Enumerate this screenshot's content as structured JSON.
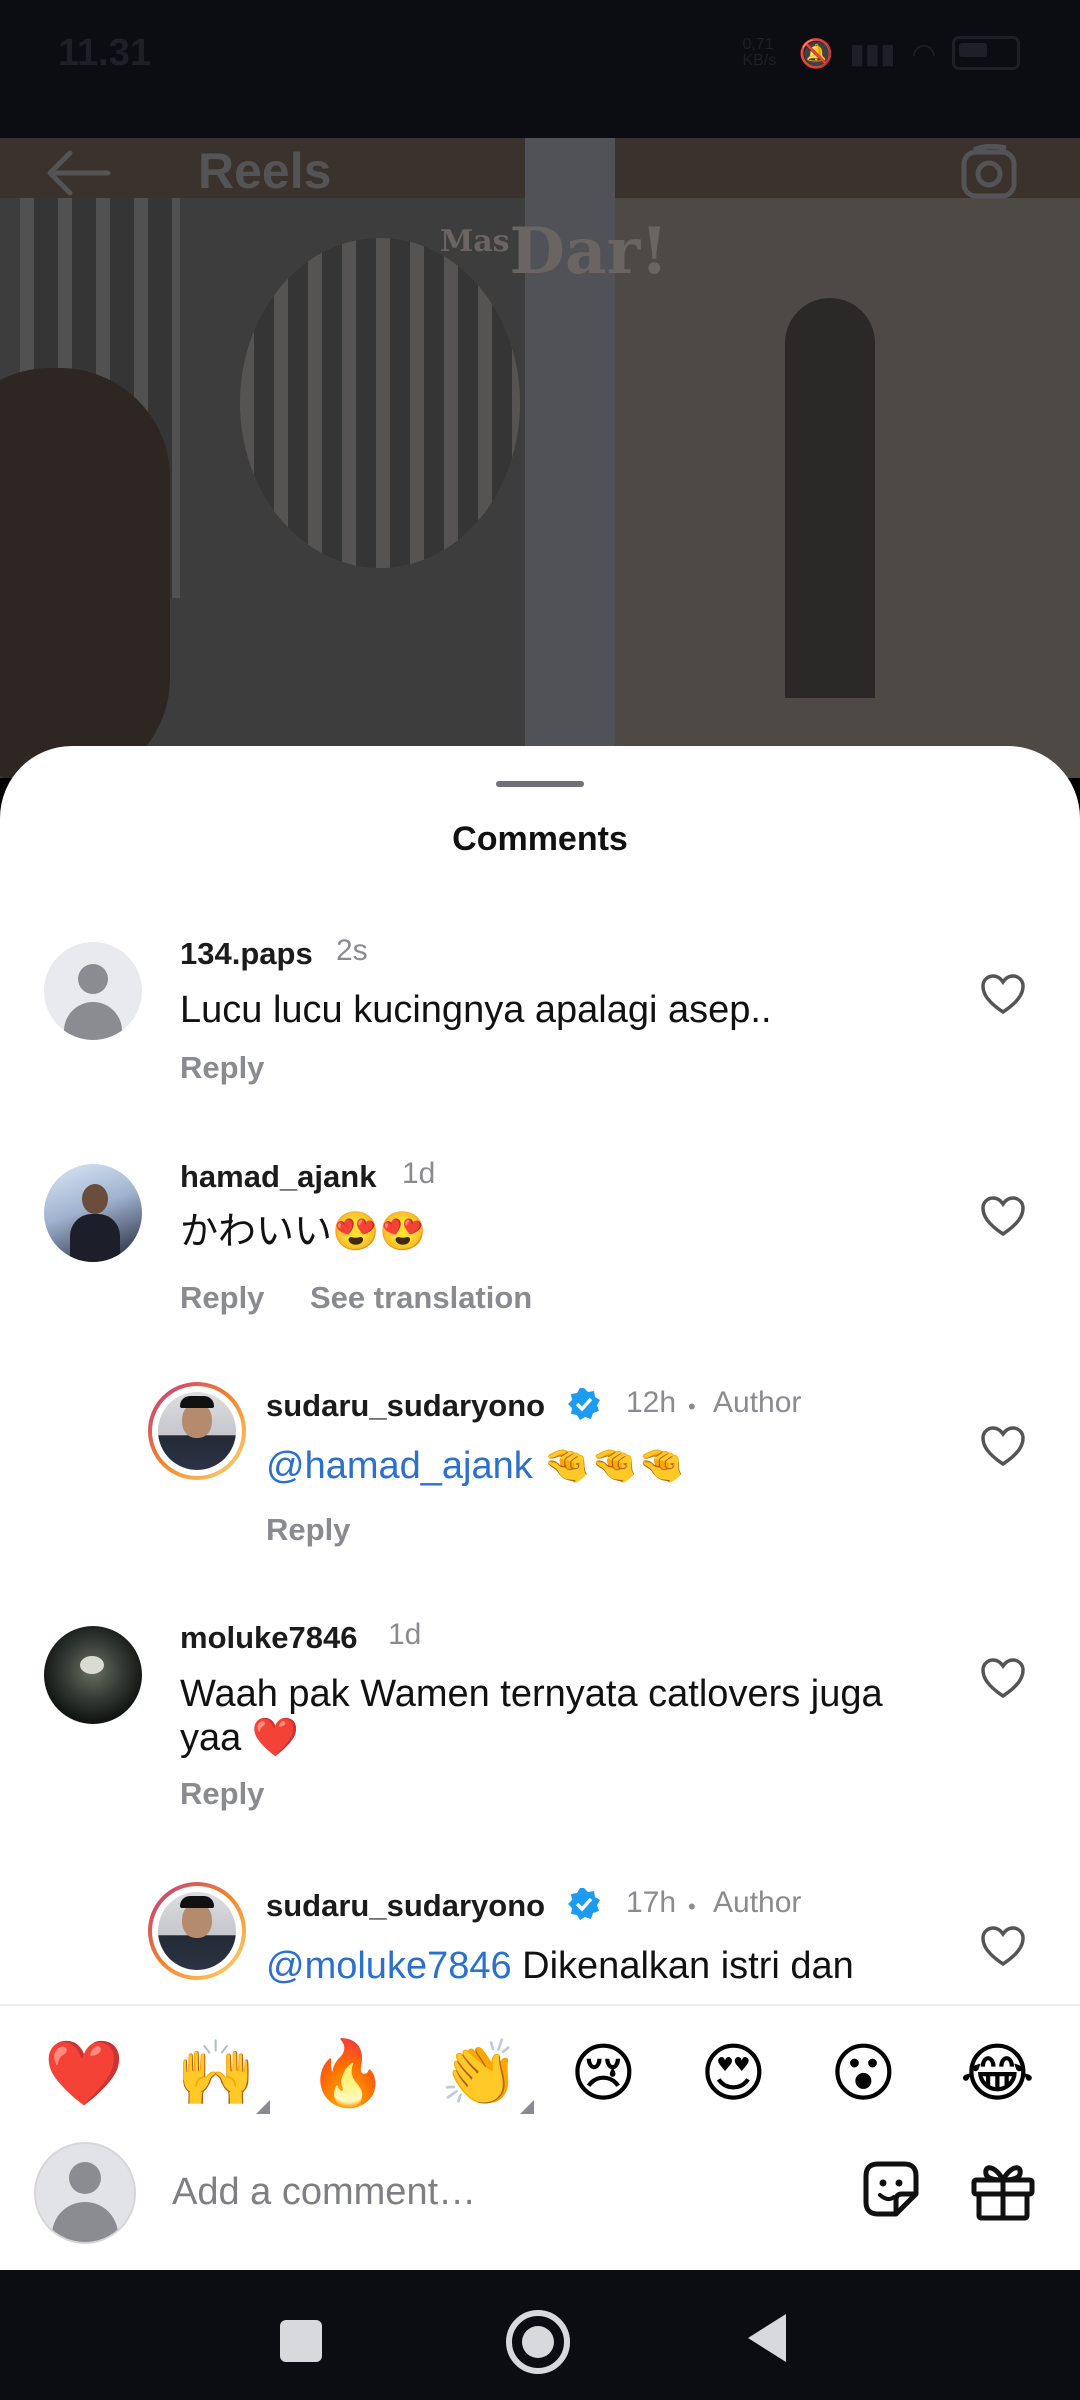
{
  "status_bar": {
    "time": "11.31",
    "net_speed": "0,71 KB/s"
  },
  "header": {
    "title": "Reels",
    "watermark_prefix": "Mas",
    "watermark": "Dar!"
  },
  "sheet": {
    "title": "Comments"
  },
  "comments": [
    {
      "username": "134.paps",
      "time": "2s",
      "text": "Lucu lucu kucingnya apalagi asep..",
      "reply": "Reply"
    },
    {
      "username": "hamad_ajank",
      "time": "1d",
      "text": "かわいい😍😍",
      "reply": "Reply",
      "see_translation": "See translation"
    },
    {
      "username": "sudaru_sudaryono",
      "verified": true,
      "time": "12h",
      "separator": "•",
      "author_label": "Author",
      "mention": "@hamad_ajank",
      "text": " 🤏🤏🤏",
      "reply": "Reply"
    },
    {
      "username": "moluke7846",
      "time": "1d",
      "text": "Waah pak Wamen ternyata catlovers juga yaa ❤️",
      "reply": "Reply"
    },
    {
      "username": "sudaru_sudaryono",
      "verified": true,
      "time": "17h",
      "separator": "•",
      "author_label": "Author",
      "mention": "@moluke7846",
      "text": " Dikenalkan istri dan"
    }
  ],
  "emoji_bar": [
    "❤️",
    "🙌",
    "🔥",
    "👏",
    "😢",
    "😍",
    "😮",
    "😂"
  ],
  "composer": {
    "placeholder": "Add a comment…"
  },
  "colors": {
    "accent_link": "#2b6fcf",
    "verified_blue": "#1d9bf0",
    "muted": "#8a8b91"
  }
}
